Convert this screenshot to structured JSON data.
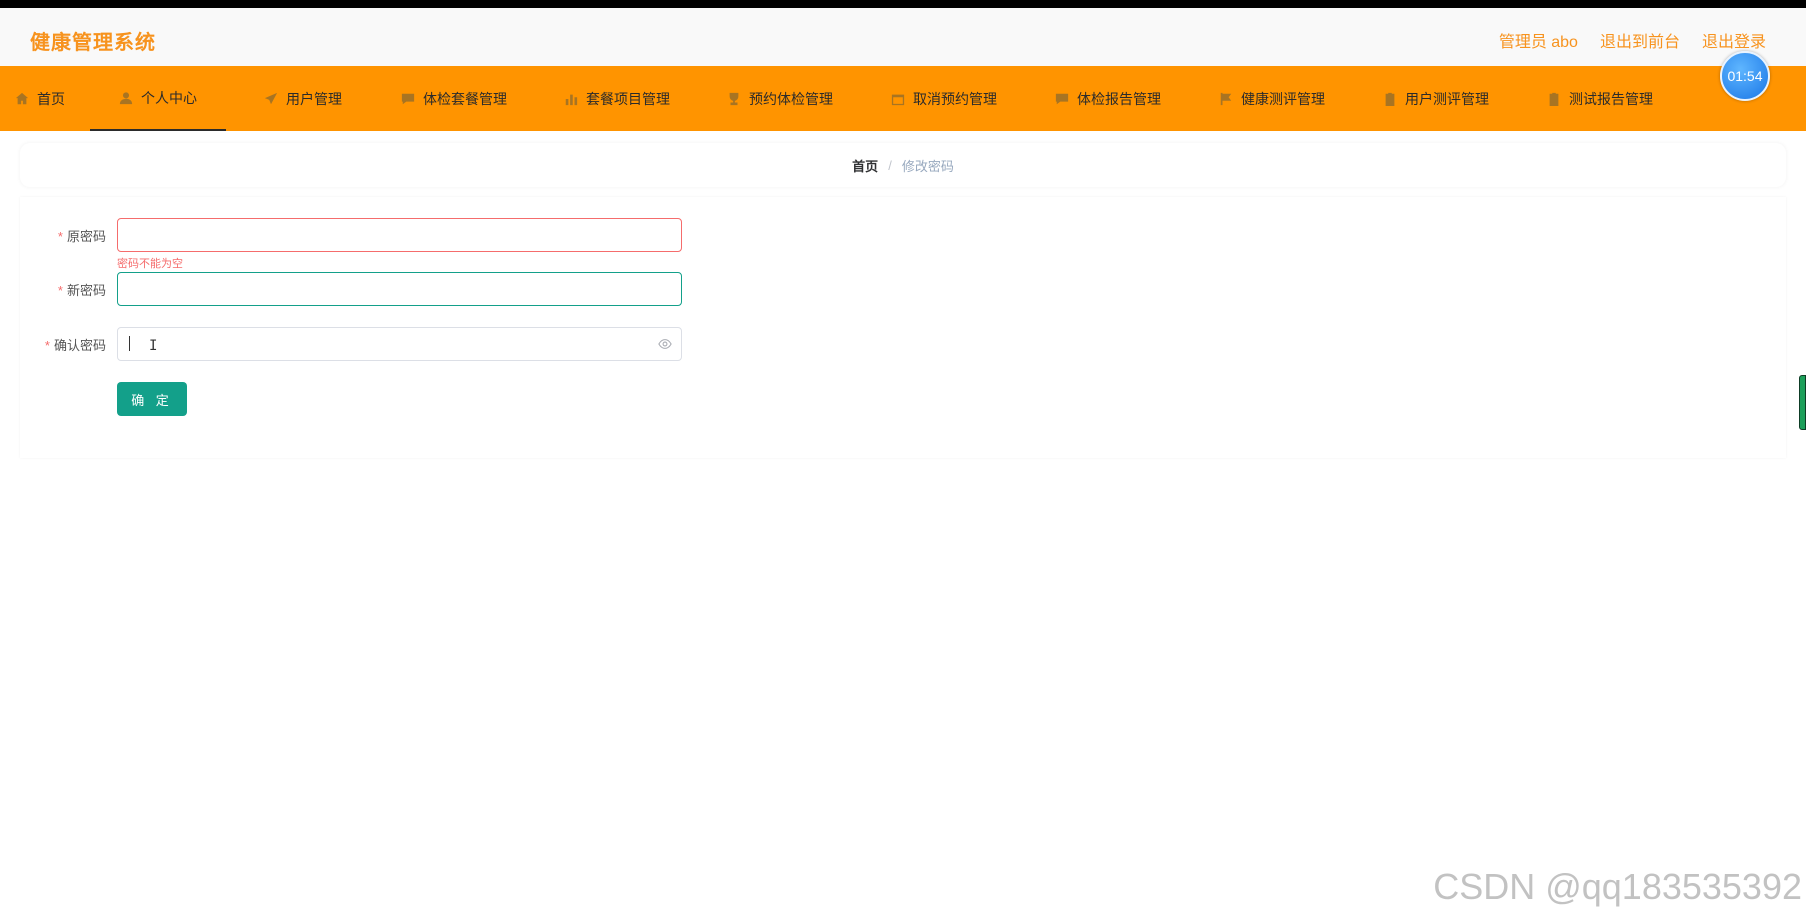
{
  "header": {
    "title": "健康管理系统",
    "links": [
      "管理员 abo",
      "退出到前台",
      "退出登录"
    ]
  },
  "nav": {
    "items": [
      {
        "label": "首页",
        "icon": "home-icon"
      },
      {
        "label": "个人中心",
        "icon": "user-icon",
        "active": true
      },
      {
        "label": "用户管理",
        "icon": "send-icon"
      },
      {
        "label": "体检套餐管理",
        "icon": "chat-icon"
      },
      {
        "label": "套餐项目管理",
        "icon": "bar-chart-icon"
      },
      {
        "label": "预约体检管理",
        "icon": "trophy-icon"
      },
      {
        "label": "取消预约管理",
        "icon": "calendar-icon"
      },
      {
        "label": "体检报告管理",
        "icon": "chat-icon"
      },
      {
        "label": "健康测评管理",
        "icon": "flag-icon"
      },
      {
        "label": "用户测评管理",
        "icon": "clipboard-icon"
      },
      {
        "label": "测试报告管理",
        "icon": "clipboard-icon"
      }
    ]
  },
  "timer": {
    "value": "01:54"
  },
  "breadcrumb": {
    "home": "首页",
    "separator": "/",
    "current": "修改密码"
  },
  "form": {
    "fields": [
      {
        "label": "原密码",
        "required": "*",
        "value": "",
        "error": "密码不能为空"
      },
      {
        "label": "新密码",
        "required": "*",
        "value": ""
      },
      {
        "label": "确认密码",
        "required": "*",
        "value": ""
      }
    ],
    "submit_label": "确 定"
  },
  "cursor": {
    "glyph": "I"
  },
  "watermark": "CSDN @qq183535392",
  "colors": {
    "accent": "#ff9400",
    "title": "#f7931e",
    "primary": "#13a08a",
    "error": "#f56c6c"
  }
}
